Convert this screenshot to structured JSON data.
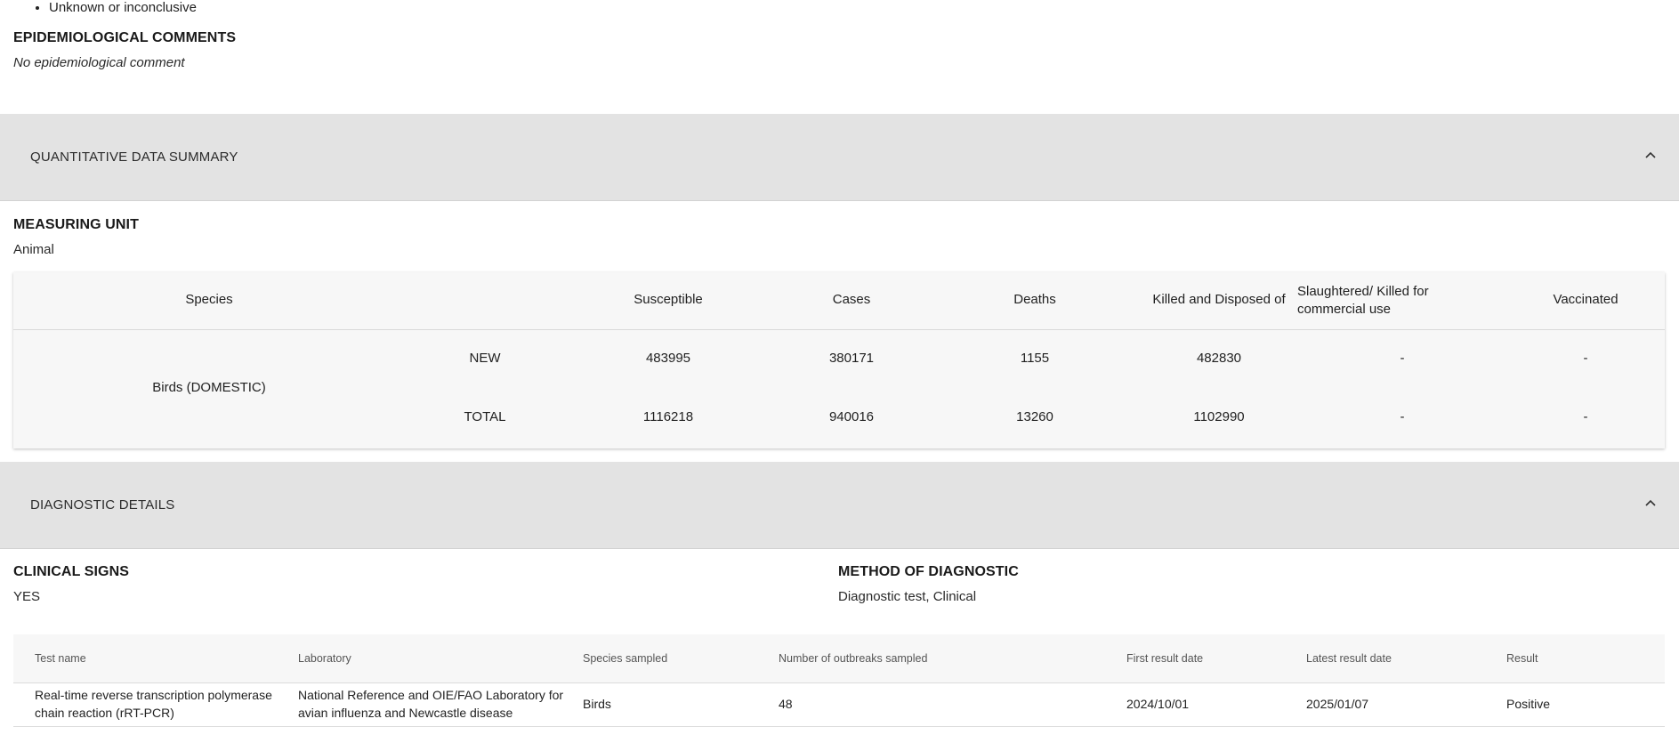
{
  "top_list": {
    "items": [
      "Unknown or inconclusive"
    ]
  },
  "epidemiological": {
    "title": "EPIDEMIOLOGICAL COMMENTS",
    "value": "No epidemiological comment"
  },
  "quantitative_section": {
    "title": "QUANTITATIVE DATA SUMMARY",
    "icon": "chevron-up-icon"
  },
  "measuring_unit": {
    "title": "MEASURING UNIT",
    "value": "Animal"
  },
  "quantity_table": {
    "headers": {
      "species": "Species",
      "susceptible": "Susceptible",
      "cases": "Cases",
      "deaths": "Deaths",
      "killed": "Killed and Disposed of",
      "slaughtered_line1": "Slaughtered/ Killed for",
      "slaughtered_line2": "commercial use",
      "vaccinated": "Vaccinated"
    },
    "species": "Birds (DOMESTIC)",
    "rows": [
      {
        "type": "NEW",
        "susceptible": "483995",
        "cases": "380171",
        "deaths": "1155",
        "killed": "482830",
        "slaughtered": "-",
        "vaccinated": "-"
      },
      {
        "type": "TOTAL",
        "susceptible": "1116218",
        "cases": "940016",
        "deaths": "13260",
        "killed": "1102990",
        "slaughtered": "-",
        "vaccinated": "-"
      }
    ]
  },
  "diagnostic_section": {
    "title": "DIAGNOSTIC DETAILS",
    "icon": "chevron-up-icon"
  },
  "clinical_signs": {
    "title": "CLINICAL SIGNS",
    "value": "YES"
  },
  "method_of_diagnostic": {
    "title": "METHOD OF DIAGNOSTIC",
    "value": "Diagnostic test, Clinical"
  },
  "diagnostic_table": {
    "headers": {
      "test_name": "Test name",
      "laboratory": "Laboratory",
      "species_sampled": "Species sampled",
      "outbreaks_sampled": "Number of outbreaks sampled",
      "first_result_date": "First result date",
      "latest_result_date": "Latest result date",
      "result": "Result"
    },
    "rows": [
      {
        "test_name_line1": "Real-time reverse transcription polymerase",
        "test_name_line2": "chain reaction (rRT-PCR)",
        "laboratory_line1": "National Reference and OIE/FAO Laboratory for",
        "laboratory_line2": "avian influenza and Newcastle disease",
        "species_sampled": "Birds",
        "outbreaks_sampled": "48",
        "first_result_date": "2024/10/01",
        "latest_result_date": "2025/01/07",
        "result": "Positive"
      }
    ]
  }
}
